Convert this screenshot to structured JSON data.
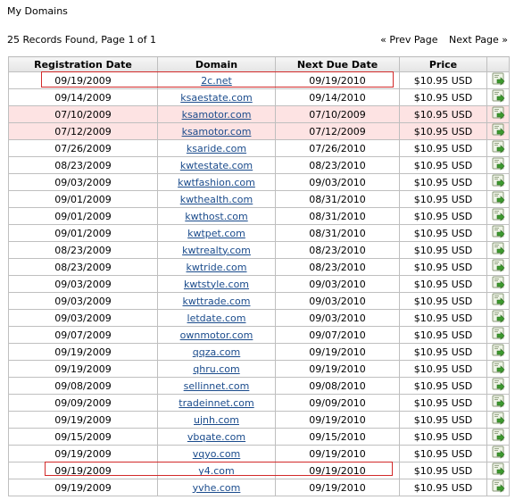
{
  "page": {
    "title": "My Domains",
    "records_text": "25 Records Found, Page 1 of 1",
    "prev_label": "« Prev Page",
    "next_label": "Next Page »"
  },
  "table": {
    "headers": [
      "Registration Date",
      "Domain",
      "Next Due Date",
      "Price",
      ""
    ],
    "rows": [
      {
        "reg": "09/19/2009",
        "domain": "2c.net",
        "due": "09/19/2010",
        "price": "$10.95 USD",
        "highlight": "box"
      },
      {
        "reg": "09/14/2009",
        "domain": "ksaestate.com",
        "due": "09/14/2010",
        "price": "$10.95 USD",
        "highlight": ""
      },
      {
        "reg": "07/10/2009",
        "domain": "ksamotor.com",
        "due": "07/10/2009",
        "price": "$10.95 USD",
        "highlight": "pink"
      },
      {
        "reg": "07/12/2009",
        "domain": "ksamotor.com",
        "due": "07/12/2009",
        "price": "$10.95 USD",
        "highlight": "pink"
      },
      {
        "reg": "07/26/2009",
        "domain": "ksaride.com",
        "due": "07/26/2010",
        "price": "$10.95 USD",
        "highlight": ""
      },
      {
        "reg": "08/23/2009",
        "domain": "kwtestate.com",
        "due": "08/23/2010",
        "price": "$10.95 USD",
        "highlight": ""
      },
      {
        "reg": "09/03/2009",
        "domain": "kwtfashion.com",
        "due": "09/03/2010",
        "price": "$10.95 USD",
        "highlight": ""
      },
      {
        "reg": "09/01/2009",
        "domain": "kwthealth.com",
        "due": "08/31/2010",
        "price": "$10.95 USD",
        "highlight": ""
      },
      {
        "reg": "09/01/2009",
        "domain": "kwthost.com",
        "due": "08/31/2010",
        "price": "$10.95 USD",
        "highlight": ""
      },
      {
        "reg": "09/01/2009",
        "domain": "kwtpet.com",
        "due": "08/31/2010",
        "price": "$10.95 USD",
        "highlight": ""
      },
      {
        "reg": "08/23/2009",
        "domain": "kwtrealty.com",
        "due": "08/23/2010",
        "price": "$10.95 USD",
        "highlight": ""
      },
      {
        "reg": "08/23/2009",
        "domain": "kwtride.com",
        "due": "08/23/2010",
        "price": "$10.95 USD",
        "highlight": ""
      },
      {
        "reg": "09/03/2009",
        "domain": "kwtstyle.com",
        "due": "09/03/2010",
        "price": "$10.95 USD",
        "highlight": ""
      },
      {
        "reg": "09/03/2009",
        "domain": "kwttrade.com",
        "due": "09/03/2010",
        "price": "$10.95 USD",
        "highlight": ""
      },
      {
        "reg": "09/03/2009",
        "domain": "letdate.com",
        "due": "09/03/2010",
        "price": "$10.95 USD",
        "highlight": ""
      },
      {
        "reg": "09/07/2009",
        "domain": "ownmotor.com",
        "due": "09/07/2010",
        "price": "$10.95 USD",
        "highlight": ""
      },
      {
        "reg": "09/19/2009",
        "domain": "qqza.com",
        "due": "09/19/2010",
        "price": "$10.95 USD",
        "highlight": ""
      },
      {
        "reg": "09/19/2009",
        "domain": "qhru.com",
        "due": "09/19/2010",
        "price": "$10.95 USD",
        "highlight": ""
      },
      {
        "reg": "09/08/2009",
        "domain": "sellinnet.com",
        "due": "09/08/2010",
        "price": "$10.95 USD",
        "highlight": ""
      },
      {
        "reg": "09/09/2009",
        "domain": "tradeinnet.com",
        "due": "09/09/2010",
        "price": "$10.95 USD",
        "highlight": ""
      },
      {
        "reg": "09/19/2009",
        "domain": "ujnh.com",
        "due": "09/19/2010",
        "price": "$10.95 USD",
        "highlight": ""
      },
      {
        "reg": "09/15/2009",
        "domain": "vbqate.com",
        "due": "09/15/2010",
        "price": "$10.95 USD",
        "highlight": ""
      },
      {
        "reg": "09/19/2009",
        "domain": "vqyo.com",
        "due": "09/19/2010",
        "price": "$10.95 USD",
        "highlight": ""
      },
      {
        "reg": "09/19/2009",
        "domain": "y4.com",
        "due": "09/19/2010",
        "price": "$10.95 USD",
        "highlight": "box"
      },
      {
        "reg": "09/19/2009",
        "domain": "yvhe.com",
        "due": "09/19/2010",
        "price": "$10.95 USD",
        "highlight": ""
      }
    ]
  },
  "colors": {
    "link": "#1a4b8c",
    "pink_row": "#fde3e3",
    "highlight_box": "#d22a2a",
    "border": "#bfbfbf"
  },
  "icons": {
    "row_action": "green-arrow-go-icon"
  }
}
